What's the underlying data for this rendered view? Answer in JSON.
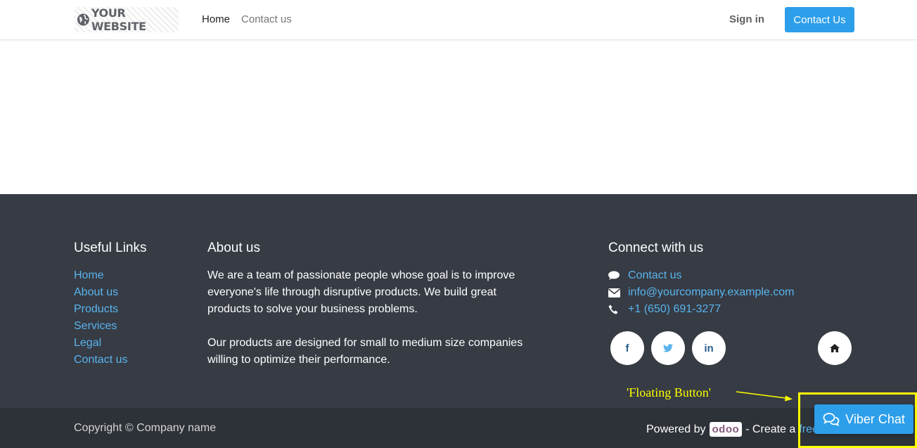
{
  "header": {
    "logo_text": "YOUR WEBSITE",
    "nav": [
      {
        "label": "Home"
      },
      {
        "label": "Contact us"
      }
    ],
    "signin_label": "Sign in",
    "contact_button_label": "Contact Us"
  },
  "footer": {
    "useful_links": {
      "title": "Useful Links",
      "items": [
        "Home",
        "About us",
        "Products",
        "Services",
        "Legal",
        "Contact us"
      ]
    },
    "about": {
      "title": "About us",
      "paragraph1": "We are a team of passionate people whose goal is to improve everyone's life through disruptive products. We build great products to solve your business problems.",
      "paragraph2": "Our products are designed for small to medium size companies willing to optimize their performance."
    },
    "connect": {
      "title": "Connect with us",
      "items": [
        {
          "icon": "comment-icon",
          "text": "Contact us"
        },
        {
          "icon": "envelope-icon",
          "text": "info@yourcompany.example.com"
        },
        {
          "icon": "phone-icon",
          "text": "+1 (650) 691-3277"
        }
      ],
      "socials": [
        {
          "icon": "facebook-icon",
          "glyph": "f"
        },
        {
          "icon": "twitter-icon",
          "glyph": ""
        },
        {
          "icon": "linkedin-icon",
          "glyph": "in"
        },
        {
          "icon": "home-icon",
          "glyph": ""
        }
      ]
    }
  },
  "bottom": {
    "copyright": "Copyright © Company name",
    "powered_by": "Powered by",
    "odoo_logo": "odoo",
    "create_text": "- Create a",
    "free_link": "free"
  },
  "annotation": {
    "label": "'Floating Button'"
  },
  "floating_button": {
    "label": "Viber Chat",
    "icon": "chat-bubbles-icon"
  },
  "colors": {
    "primary": "#2c9eea",
    "footer_bg": "#363b44",
    "bottom_bg": "#2d3138",
    "link": "#5ab4ee",
    "annotation": "#ffff00"
  }
}
